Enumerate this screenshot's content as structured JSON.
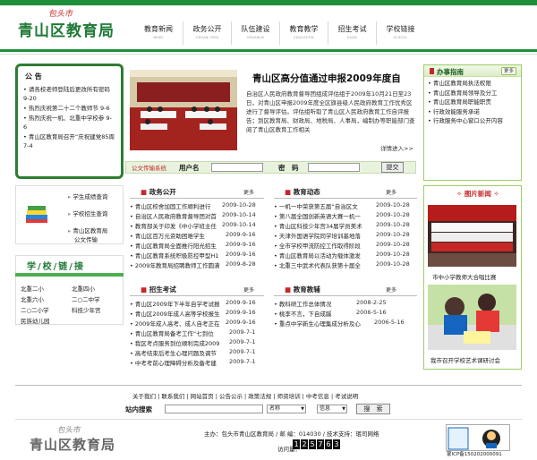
{
  "header": {
    "logo_small": "包头市",
    "logo_big": "青山区教育局",
    "nav": [
      {
        "cn": "教育新闻",
        "en": "NEWS"
      },
      {
        "cn": "政务公开",
        "en": "ORGAN OPEN"
      },
      {
        "cn": "队伍建设",
        "en": "ORGANISE"
      },
      {
        "cn": "教育教学",
        "en": "EDUCATION"
      },
      {
        "cn": "招生考试",
        "en": "EXAM"
      },
      {
        "cn": "学校链接",
        "en": "SCHOOL"
      }
    ]
  },
  "notice": {
    "title": "公 告",
    "items": [
      "• 请各校老师登陆后更改所有密码 9-20",
      "• 热烈庆祝第二十二个教师节 9-6",
      "• 热烈庆祝一机、北重中学校参 9-6",
      "• 青山区教育局召开“庆祝建党85周 7-4"
    ]
  },
  "featured": {
    "title": "青山区高分值通过申报2009年度自",
    "body": "自治区人民政府教育督导团组成评估组于2009年10月21日至23日，对青山区申报2009年度全区旗县级人民政府教育工作优秀区进行了督导评估。评估组听取了青山区人民政府教育工作自评报告；到区教育局、财政局、地税局、人事局，编制办等职能部门查阅了青山区教育工作相关",
    "more": "详情进入>>"
  },
  "login": {
    "title": "公文传输系统",
    "user_label": "用户名",
    "pass_label": "密　码",
    "submit": "提交"
  },
  "office": {
    "title": "办事指南",
    "more": "更多",
    "items": [
      "• 青山区教育局执法权限",
      "• 青山区教育局领导及分工",
      "• 青山区教育局职能职责",
      "• 行政效能服务承诺",
      "• 行政服务中心窗口公开内容"
    ]
  },
  "quicklinks": [
    "学生成绩查询",
    "学校招生查询",
    "青山区教育局",
    "公文传输"
  ],
  "school": {
    "title": "学/校/链/接",
    "items": [
      "北重二小",
      "北重四小",
      "北重六小",
      "二○二中学",
      "二○二小学",
      "科技少年宫",
      "民族幼儿园"
    ]
  },
  "politics": {
    "title": "政务公开",
    "more": "更多",
    "rows": [
      {
        "t": "• 青山区校舍加固工作顺利进行",
        "d": "2009-10-28"
      },
      {
        "t": "• 自治区人民政府教育督导团对首",
        "d": "2009-10-14"
      },
      {
        "t": "• 教育部关于印发《中小学班主任",
        "d": "2009-10-14"
      },
      {
        "t": "• 青山区百万元资助困难学生",
        "d": "2009-9-16"
      },
      {
        "t": "• 青山区教育局全面推行阳光招生",
        "d": "2009-9-16"
      },
      {
        "t": "• 青山区教育系统积极防控甲型H1",
        "d": "2009-9-16"
      },
      {
        "t": "• 2009年教育局招聘教师工作圆满",
        "d": "2009-8-28"
      }
    ]
  },
  "dynamics": {
    "title": "教育动态",
    "more": "更多",
    "rows": [
      {
        "t": "• 一机一中荣获第五届“自治区文",
        "d": "2009-10-28"
      },
      {
        "t": "• 第八届全国创新英语大赛一机一",
        "d": "2009-10-28"
      },
      {
        "t": "• 青山区科技少年宫34届学员美术",
        "d": "2009-10-28"
      },
      {
        "t": "• 天津外国语学院同学培训基地落",
        "d": "2009-10-28"
      },
      {
        "t": "• 全市学校甲流防控工作取得阶段",
        "d": "2009-10-28"
      },
      {
        "t": "• 青山区教育局以活动为载体激发",
        "d": "2009-10-28"
      },
      {
        "t": "• 北重三中武术代表队获第十届全",
        "d": "2009-10-28"
      }
    ]
  },
  "exam": {
    "title": "招生考试",
    "more": "更多",
    "rows": [
      {
        "t": "• 青山区2009年下半年自学考试报",
        "d": "2009-9-16"
      },
      {
        "t": "• 青山区2009年成人高等学校报生",
        "d": "2009-9-16"
      },
      {
        "t": "• 2009年成人高考、成人自考正在",
        "d": "2009-9-16"
      },
      {
        "t": "• 青山区教育局备考工作“七到位",
        "d": "2009-7-1"
      },
      {
        "t": "• 我区考点服务到位顺利完成2009",
        "d": "2009-7-1"
      },
      {
        "t": "• 高考结束后考生心理问题及调节",
        "d": "2009-7-1"
      },
      {
        "t": "• 中考考前心理障碍分析及备考建",
        "d": "2009-7-1"
      }
    ]
  },
  "research": {
    "title": "教育教辅",
    "more": "更多",
    "rows": [
      {
        "t": "• 教科研工作总体情况",
        "d": "2008-2-25"
      },
      {
        "t": "• 桃李不言，下自成蹊",
        "d": "2006-5-16"
      },
      {
        "t": "• 重点中学新生心理集成分析及心",
        "d": "2006-5-16"
      }
    ]
  },
  "photo_news": {
    "title": "图片新闻",
    "cap1": "市中小学教师大合唱比赛",
    "cap2": "我市召开学校艺术课研讨会"
  },
  "footer": {
    "links": "关于我们 | 联系我们 | 网站首页 | 公告公示 | 政策法规 | 师资培训 | 中考信息 | 考试说明",
    "search_label": "站内搜索",
    "select1": "名称",
    "select2": "信息",
    "search_btn": "搜　索",
    "logo_small": "包头市",
    "logo_big": "青山区教育局",
    "info": "主办：包头市青山区教育局 / 邮 编：014030 / 技术支持：珉司网络",
    "counter_label": "访问量：",
    "counter": [
      "1",
      "2",
      "5",
      "7",
      "6",
      "3"
    ],
    "badge": "蒙ICP备150202000091"
  }
}
